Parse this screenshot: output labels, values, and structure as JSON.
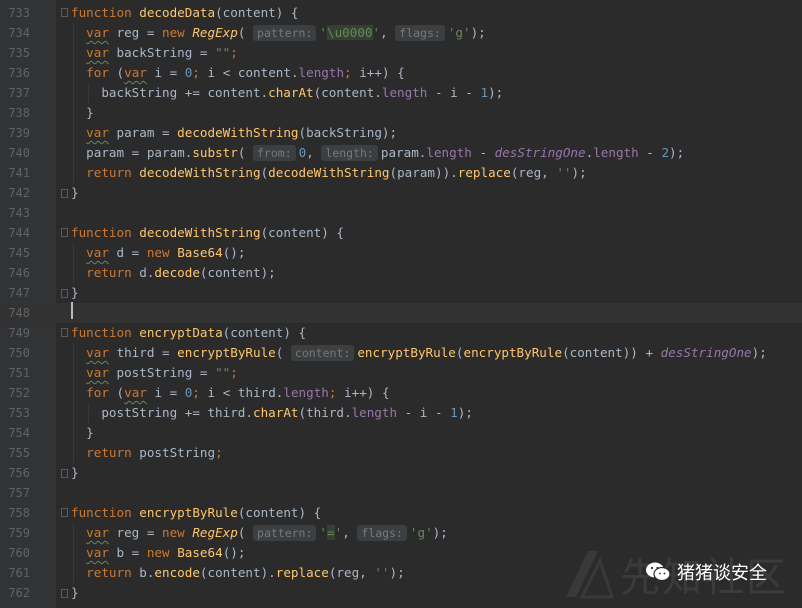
{
  "editor": {
    "current_line": "748",
    "lines": [
      {
        "n": "733",
        "tokens": [
          [
            "kw",
            "function "
          ],
          [
            "fn",
            "decodeData"
          ],
          [
            "",
            "(content) {"
          ]
        ]
      },
      {
        "n": "734",
        "tokens": [
          [
            "",
            "  "
          ],
          [
            "var",
            "var"
          ],
          [
            "",
            " reg = "
          ],
          [
            "kw",
            "new "
          ],
          [
            "cls",
            "RegExp"
          ],
          [
            "",
            "( "
          ],
          [
            "hint",
            "pattern:"
          ],
          [
            "str",
            "'"
          ],
          [
            "esc",
            "\\u0000"
          ],
          [
            "str",
            "'"
          ],
          [
            ", "
          ],
          [
            "hint",
            "flags:"
          ],
          [
            "str",
            "'g'"
          ],
          [
            "",
            ");"
          ]
        ]
      },
      {
        "n": "735",
        "tokens": [
          [
            "",
            "  "
          ],
          [
            "var",
            "var"
          ],
          [
            "",
            " backString = "
          ],
          [
            "str",
            "\"\""
          ],
          [
            "kw",
            ";"
          ]
        ]
      },
      {
        "n": "736",
        "tokens": [
          [
            "",
            "  "
          ],
          [
            "kw",
            "for "
          ],
          [
            "",
            "("
          ],
          [
            "var",
            "var"
          ],
          [
            "",
            " i = "
          ],
          [
            "num",
            "0"
          ],
          [
            "kw",
            "; "
          ],
          [
            "",
            "i < content."
          ],
          [
            "prop",
            "length"
          ],
          [
            "kw",
            "; "
          ],
          [
            "",
            "i++) {"
          ]
        ]
      },
      {
        "n": "737",
        "tokens": [
          [
            "",
            "    backString += content."
          ],
          [
            "fn",
            "charAt"
          ],
          [
            "",
            "(content."
          ],
          [
            "prop",
            "length"
          ],
          [
            "",
            " - i - "
          ],
          [
            "num",
            "1"
          ],
          [
            "",
            ");"
          ]
        ]
      },
      {
        "n": "738",
        "tokens": [
          [
            "",
            "  }"
          ]
        ]
      },
      {
        "n": "739",
        "tokens": [
          [
            "",
            "  "
          ],
          [
            "var",
            "var"
          ],
          [
            "",
            " param = "
          ],
          [
            "fn",
            "decodeWithString"
          ],
          [
            "",
            "(backString);"
          ]
        ]
      },
      {
        "n": "740",
        "tokens": [
          [
            "",
            "  param = param."
          ],
          [
            "fn",
            "substr"
          ],
          [
            "",
            "( "
          ],
          [
            "hint",
            "from:"
          ],
          [
            "num",
            "0"
          ],
          [
            "",
            ", "
          ],
          [
            "hint",
            "length:"
          ],
          [
            "",
            "param."
          ],
          [
            "prop",
            "length"
          ],
          [
            "",
            " - "
          ],
          [
            "glob",
            "desStringOne"
          ],
          [
            "",
            "."
          ],
          [
            "prop",
            "length"
          ],
          [
            "",
            " - "
          ],
          [
            "num",
            "2"
          ],
          [
            "",
            ");"
          ]
        ]
      },
      {
        "n": "741",
        "tokens": [
          [
            "",
            "  "
          ],
          [
            "kw",
            "return "
          ],
          [
            "fn",
            "decodeWithString"
          ],
          [
            "",
            "("
          ],
          [
            "fn",
            "decodeWithString"
          ],
          [
            "",
            "(param))."
          ],
          [
            "fn",
            "replace"
          ],
          [
            "",
            "(reg, "
          ],
          [
            "str",
            "''"
          ],
          [
            "",
            ");"
          ]
        ]
      },
      {
        "n": "742",
        "tokens": [
          [
            "",
            "}"
          ]
        ]
      },
      {
        "n": "743",
        "tokens": []
      },
      {
        "n": "744",
        "tokens": [
          [
            "kw",
            "function "
          ],
          [
            "fn",
            "decodeWithString"
          ],
          [
            "",
            "(content) {"
          ]
        ]
      },
      {
        "n": "745",
        "tokens": [
          [
            "",
            "  "
          ],
          [
            "var",
            "var"
          ],
          [
            "",
            " d = "
          ],
          [
            "kw",
            "new "
          ],
          [
            "fn",
            "Base64"
          ],
          [
            "",
            "();"
          ]
        ]
      },
      {
        "n": "746",
        "tokens": [
          [
            "",
            "  "
          ],
          [
            "kw",
            "return "
          ],
          [
            "",
            "d."
          ],
          [
            "fn",
            "decode"
          ],
          [
            "",
            "(content);"
          ]
        ]
      },
      {
        "n": "747",
        "tokens": [
          [
            "",
            "}"
          ]
        ]
      },
      {
        "n": "748",
        "tokens": []
      },
      {
        "n": "749",
        "tokens": [
          [
            "kw",
            "function "
          ],
          [
            "fn",
            "encryptData"
          ],
          [
            "",
            "(content) {"
          ]
        ]
      },
      {
        "n": "750",
        "tokens": [
          [
            "",
            "  "
          ],
          [
            "var",
            "var"
          ],
          [
            "",
            " third = "
          ],
          [
            "fn",
            "encryptByRule"
          ],
          [
            "",
            "( "
          ],
          [
            "hint",
            "content:"
          ],
          [
            "fn",
            "encryptByRule"
          ],
          [
            "",
            "("
          ],
          [
            "fn",
            "encryptByRule"
          ],
          [
            "",
            "(content)) + "
          ],
          [
            "glob",
            "desStringOne"
          ],
          [
            "",
            ");"
          ]
        ]
      },
      {
        "n": "751",
        "tokens": [
          [
            "",
            "  "
          ],
          [
            "var",
            "var"
          ],
          [
            "",
            " postString = "
          ],
          [
            "str",
            "\"\""
          ],
          [
            "kw",
            ";"
          ]
        ]
      },
      {
        "n": "752",
        "tokens": [
          [
            "",
            "  "
          ],
          [
            "kw",
            "for "
          ],
          [
            "",
            "("
          ],
          [
            "var",
            "var"
          ],
          [
            "",
            " i = "
          ],
          [
            "num",
            "0"
          ],
          [
            "kw",
            "; "
          ],
          [
            "",
            "i < third."
          ],
          [
            "prop",
            "length"
          ],
          [
            "kw",
            "; "
          ],
          [
            "",
            "i++) {"
          ]
        ]
      },
      {
        "n": "753",
        "tokens": [
          [
            "",
            "    postString += third."
          ],
          [
            "fn",
            "charAt"
          ],
          [
            "",
            "(third."
          ],
          [
            "prop",
            "length"
          ],
          [
            "",
            " - i - "
          ],
          [
            "num",
            "1"
          ],
          [
            "",
            ");"
          ]
        ]
      },
      {
        "n": "754",
        "tokens": [
          [
            "",
            "  }"
          ]
        ]
      },
      {
        "n": "755",
        "tokens": [
          [
            "",
            "  "
          ],
          [
            "kw",
            "return "
          ],
          [
            "",
            "postString"
          ],
          [
            "kw",
            ";"
          ]
        ]
      },
      {
        "n": "756",
        "tokens": [
          [
            "",
            "}"
          ]
        ]
      },
      {
        "n": "757",
        "tokens": []
      },
      {
        "n": "758",
        "tokens": [
          [
            "kw",
            "function "
          ],
          [
            "fn",
            "encryptByRule"
          ],
          [
            "",
            "(content) {"
          ]
        ]
      },
      {
        "n": "759",
        "tokens": [
          [
            "",
            "  "
          ],
          [
            "var",
            "var"
          ],
          [
            "",
            " reg = "
          ],
          [
            "kw",
            "new "
          ],
          [
            "cls",
            "RegExp"
          ],
          [
            "",
            "( "
          ],
          [
            "hint",
            "pattern:"
          ],
          [
            "str",
            "'"
          ],
          [
            "esc",
            "="
          ],
          [
            "str",
            "'"
          ],
          [
            "",
            ", "
          ],
          [
            "hint",
            "flags:"
          ],
          [
            "str",
            "'g'"
          ],
          [
            "",
            ");"
          ]
        ]
      },
      {
        "n": "760",
        "tokens": [
          [
            "",
            "  "
          ],
          [
            "var",
            "var"
          ],
          [
            "",
            " b = "
          ],
          [
            "kw",
            "new "
          ],
          [
            "fn",
            "Base64"
          ],
          [
            "",
            "();"
          ]
        ]
      },
      {
        "n": "761",
        "tokens": [
          [
            "",
            "  "
          ],
          [
            "kw",
            "return "
          ],
          [
            "",
            "b."
          ],
          [
            "fn",
            "encode"
          ],
          [
            "",
            "(content)."
          ],
          [
            "fn",
            "replace"
          ],
          [
            "",
            "(reg, "
          ],
          [
            "str",
            "''"
          ],
          [
            "",
            ");"
          ]
        ]
      },
      {
        "n": "762",
        "tokens": [
          [
            "",
            "}"
          ]
        ]
      }
    ]
  },
  "watermark": {
    "site_text": "先知社区",
    "wechat_account": "猪猪谈安全"
  },
  "colors": {
    "background": "#2b2b2b",
    "gutter": "#313335",
    "keyword": "#cc7832",
    "function": "#ffc66d",
    "string": "#6a8759",
    "number": "#6897bb",
    "property": "#9876aa"
  }
}
